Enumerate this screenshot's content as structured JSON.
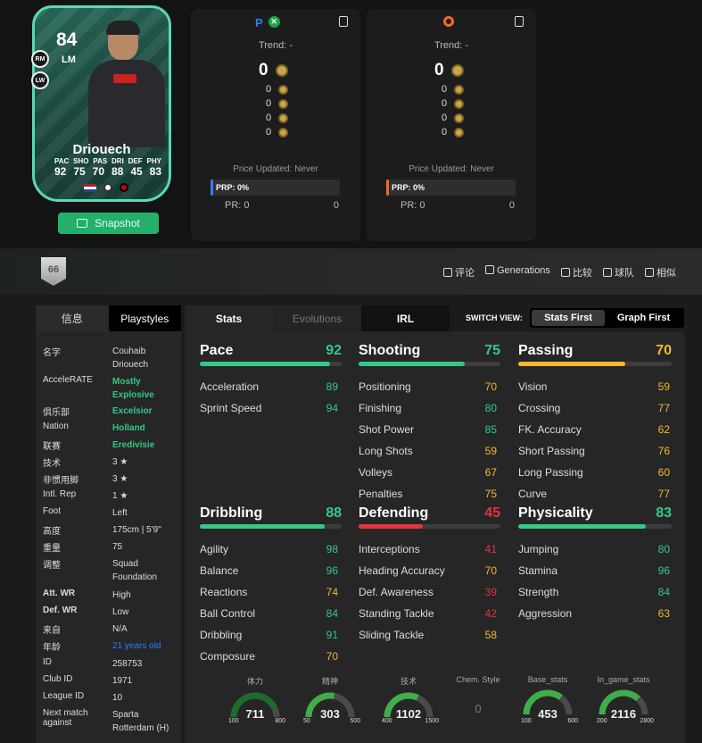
{
  "card": {
    "rating": "84",
    "position": "LM",
    "alt_positions": [
      "RM",
      "LW"
    ],
    "name": "Driouech",
    "stat_labels": [
      "PAC",
      "SHO",
      "PAS",
      "DRI",
      "DEF",
      "PHY"
    ],
    "stat_values": [
      "92",
      "75",
      "70",
      "88",
      "45",
      "83"
    ],
    "snapshot_label": "Snapshot"
  },
  "price_panels": [
    {
      "platform": "playstation-xbox",
      "trend": "Trend: -",
      "price": "0",
      "prices": [
        "0",
        "0",
        "0",
        "0"
      ],
      "updated": "Price Updated: Never",
      "prp": "PRP: 0%",
      "pr_label": "PR: 0",
      "pr_value": "0",
      "accent": "#2f80ff"
    },
    {
      "platform": "pc",
      "trend": "Trend: -",
      "price": "0",
      "prices": [
        "0",
        "0",
        "0",
        "0"
      ],
      "updated": "Price Updated: Never",
      "prp": "PRP: 0%",
      "pr_label": "PR: 0",
      "pr_value": "0",
      "accent": "#f56a1d"
    }
  ],
  "nav": {
    "badge": "66",
    "items": [
      "评论",
      "Generations",
      "比较",
      "球队",
      "相似"
    ]
  },
  "left_tabs": [
    "信息",
    "Playstyles"
  ],
  "info": [
    {
      "k": "名字",
      "v": "Couhaib Driouech"
    },
    {
      "k": "AcceleRATE",
      "v": "Mostly Explosive"
    },
    {
      "k": "俱乐部",
      "v": "Excelsior"
    },
    {
      "k": "Nation",
      "v": "Holland"
    },
    {
      "k": "联赛",
      "v": "Eredivisie"
    },
    {
      "k": "技术",
      "v": "3 ★"
    },
    {
      "k": "非惯用脚",
      "v": "3 ★"
    },
    {
      "k": "Intl. Rep",
      "v": "1 ★"
    },
    {
      "k": "Foot",
      "v": "Left"
    },
    {
      "k": "高度",
      "v": "175cm | 5'9\""
    },
    {
      "k": "重量",
      "v": "75"
    },
    {
      "k": "调整",
      "v": "Squad Foundation"
    },
    {
      "k": "Att. WR",
      "v": "High"
    },
    {
      "k": "Def. WR",
      "v": "Low"
    },
    {
      "k": "来自",
      "v": "N/A"
    },
    {
      "k": "年龄",
      "v": "21 years old"
    },
    {
      "k": "ID",
      "v": "258753"
    },
    {
      "k": "Club ID",
      "v": "1971"
    },
    {
      "k": "League ID",
      "v": "10"
    },
    {
      "k": "Next match against",
      "v": "Sparta Rotterdam (H)"
    }
  ],
  "tabs": [
    "Stats",
    "Evolutions",
    "IRL"
  ],
  "switch": {
    "label": "SWITCH VIEW:",
    "a": "Stats First",
    "b": "Graph First"
  },
  "categories": [
    {
      "name": "Pace",
      "value": 92,
      "color": "#35c985",
      "attrs": [
        [
          "Acceleration",
          "89"
        ],
        [
          "Sprint Speed",
          "94"
        ]
      ]
    },
    {
      "name": "Shooting",
      "value": 75,
      "color": "#35c985",
      "attrs": [
        [
          "Positioning",
          "70"
        ],
        [
          "Finishing",
          "80"
        ],
        [
          "Shot Power",
          "85"
        ],
        [
          "Long Shots",
          "59"
        ],
        [
          "Volleys",
          "67"
        ],
        [
          "Penalties",
          "75"
        ]
      ]
    },
    {
      "name": "Passing",
      "value": 70,
      "color": "#f5b731",
      "attrs": [
        [
          "Vision",
          "59"
        ],
        [
          "Crossing",
          "77"
        ],
        [
          "FK. Accuracy",
          "62"
        ],
        [
          "Short Passing",
          "76"
        ],
        [
          "Long Passing",
          "60"
        ],
        [
          "Curve",
          "77"
        ]
      ]
    },
    {
      "name": "Dribbling",
      "value": 88,
      "color": "#35c985",
      "attrs": [
        [
          "Agility",
          "98"
        ],
        [
          "Balance",
          "96"
        ],
        [
          "Reactions",
          "74"
        ],
        [
          "Ball Control",
          "84"
        ],
        [
          "Dribbling",
          "91"
        ],
        [
          "Composure",
          "70"
        ]
      ]
    },
    {
      "name": "Defending",
      "value": 45,
      "color": "#e5333f",
      "attrs": [
        [
          "Interceptions",
          "41"
        ],
        [
          "Heading Accuracy",
          "70"
        ],
        [
          "Def. Awareness",
          "39"
        ],
        [
          "Standing Tackle",
          "42"
        ],
        [
          "Sliding Tackle",
          "58"
        ]
      ]
    },
    {
      "name": "Physicality",
      "value": 83,
      "color": "#35c985",
      "attrs": [
        [
          "Jumping",
          "80"
        ],
        [
          "Stamina",
          "96"
        ],
        [
          "Strength",
          "84"
        ],
        [
          "Aggression",
          "63"
        ]
      ]
    }
  ],
  "gauges": [
    {
      "title": "体力",
      "value": "711",
      "min": "100",
      "max": "800",
      "frac": 0.87
    },
    {
      "title": "精神",
      "value": "303",
      "min": "50",
      "max": "500",
      "frac": 0.56
    },
    {
      "title": "技术",
      "value": "1102",
      "min": "400",
      "max": "1500",
      "frac": 0.64
    },
    {
      "title": "Chem. Style",
      "value": "0",
      "min": "",
      "max": "",
      "frac": null
    },
    {
      "title": "Base_stats",
      "value": "453",
      "min": "100",
      "max": "600",
      "frac": 0.71
    },
    {
      "title": "In_game_stats",
      "value": "2116",
      "min": "200",
      "max": "2800",
      "frac": 0.74
    }
  ]
}
